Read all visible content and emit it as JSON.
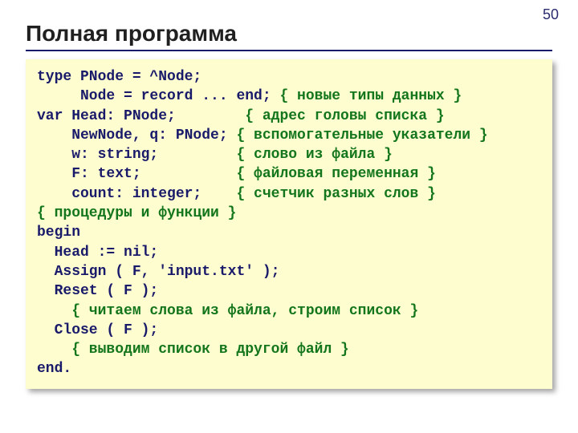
{
  "page_number": "50",
  "title": "Полная программа",
  "code": {
    "l1": "type PNode = ^Node;",
    "l2a": "     Node = record ... end;",
    "l2c": " { новые типы данных }",
    "l3a": "var Head: PNode;",
    "l3c": "        { адрес головы списка }",
    "l4a": "    NewNode, q: PNode;",
    "l4c": " { вспомогательные указатели }",
    "l5a": "    w: string;",
    "l5c": "         { слово из файла }",
    "l6a": "    F: text;",
    "l6c": "           { файловая переменная }",
    "l7a": "    count: integer;",
    "l7c": "    { счетчик разных слов }",
    "l8": "{ процедуры и функции }",
    "l9": "begin",
    "l10": "  Head := nil;",
    "l11": "  Assign ( F, 'input.txt' );",
    "l12": "  Reset ( F );",
    "l13": "    { читаем слова из файла, строим список }",
    "l14": "  Close ( F );",
    "l15": "    { выводим список в другой файл }",
    "l16": "end."
  }
}
